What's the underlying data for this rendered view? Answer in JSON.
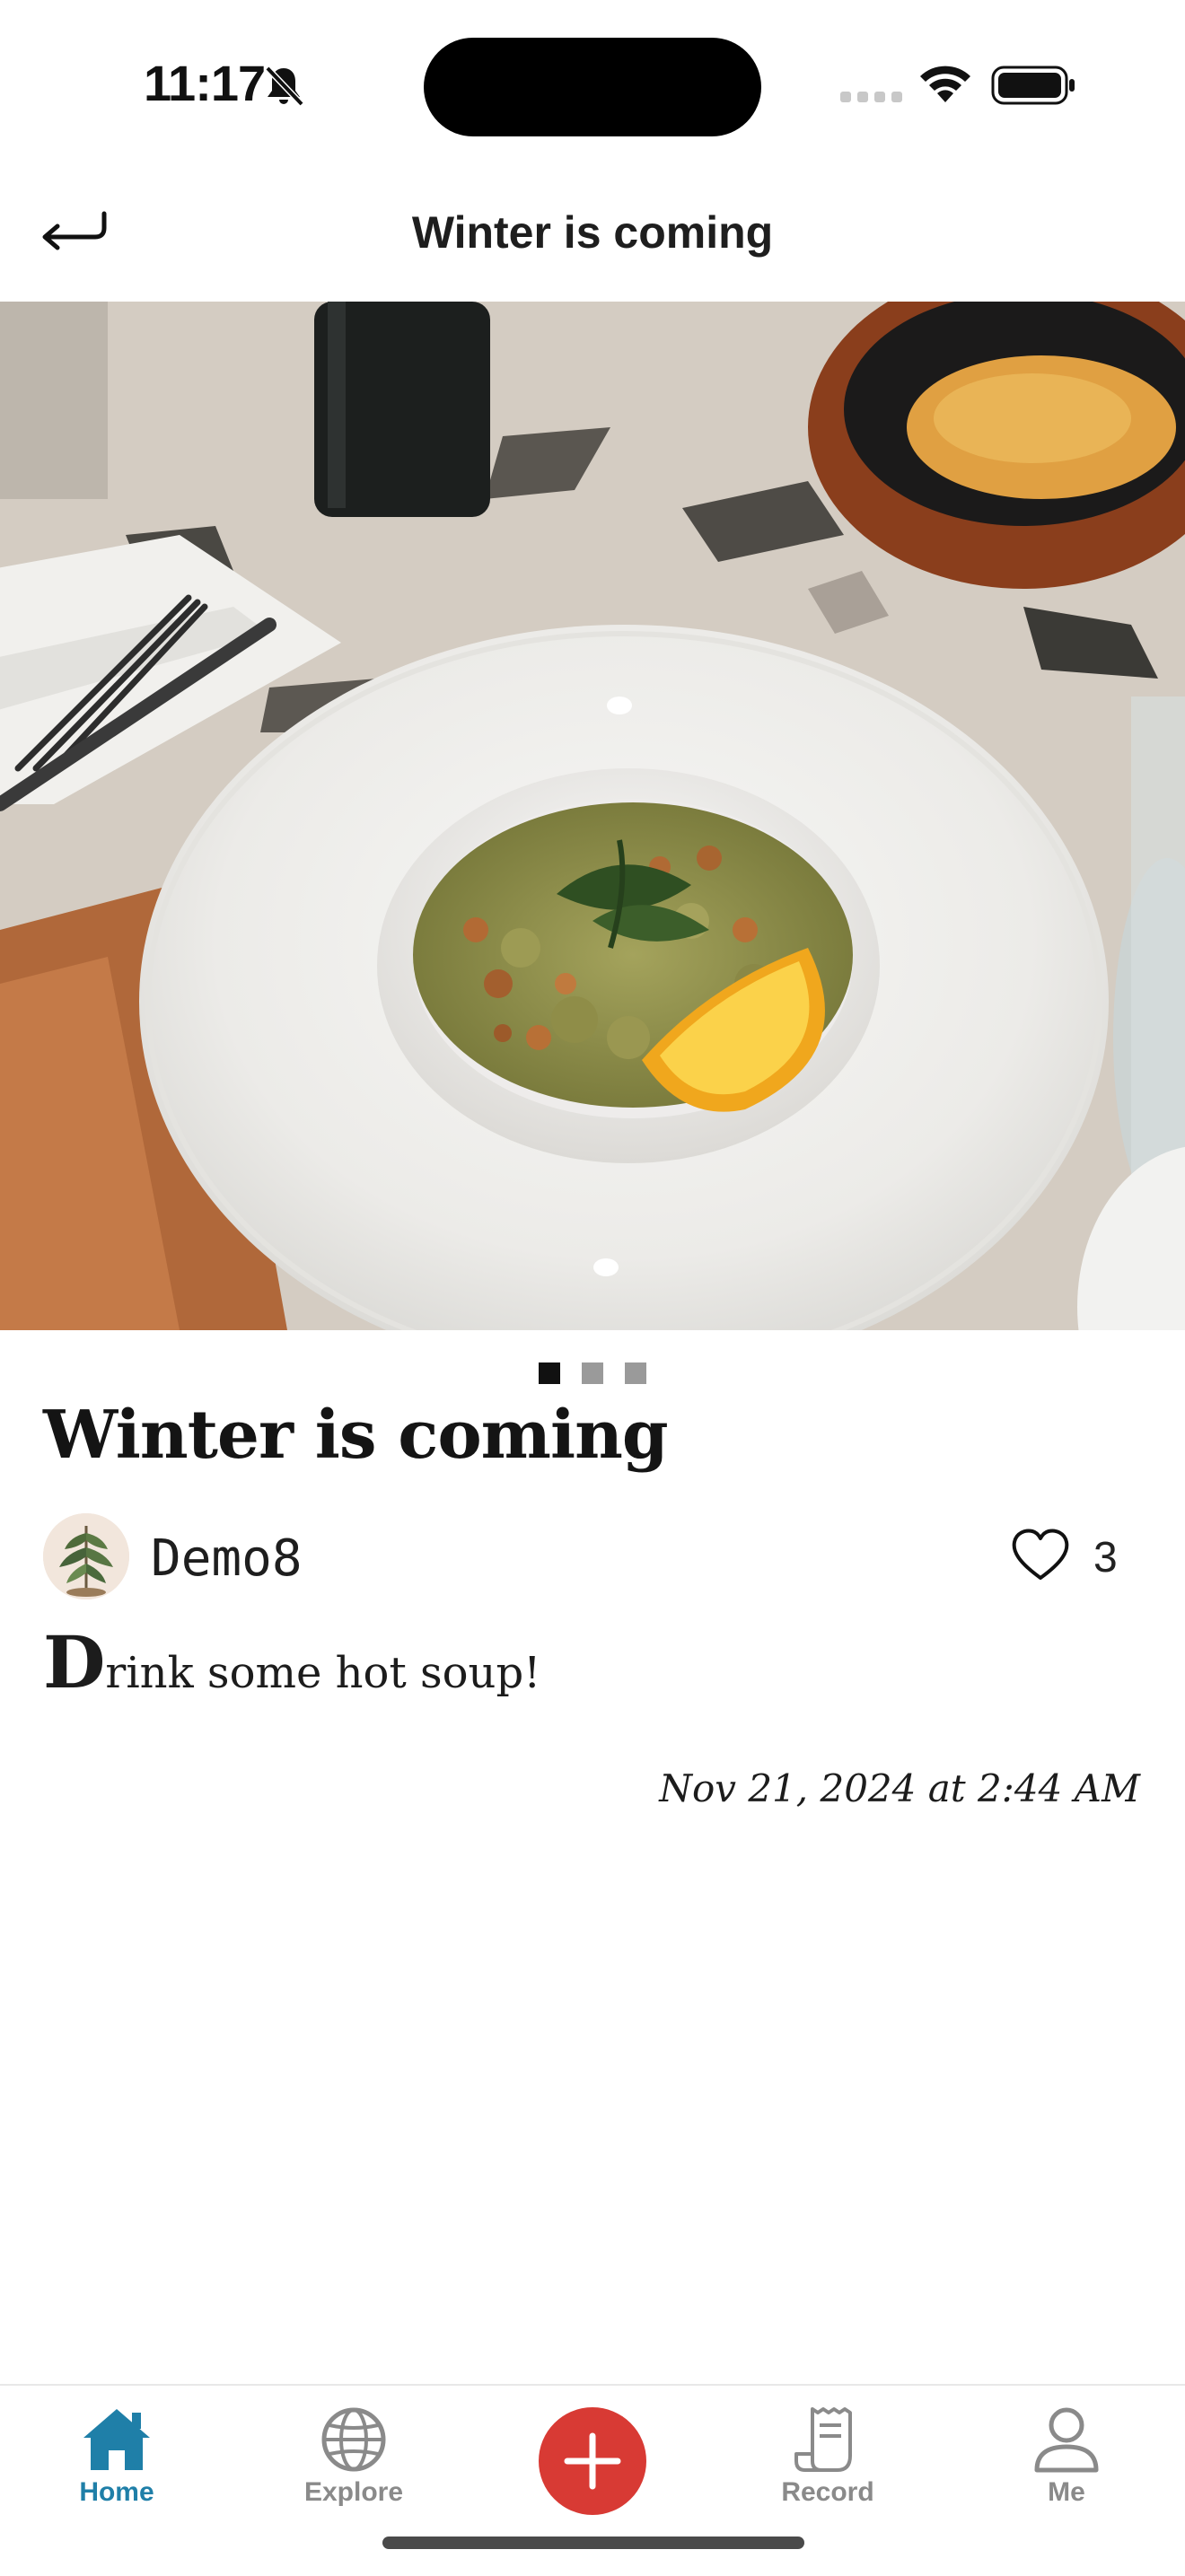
{
  "status_bar": {
    "time": "11:17",
    "icons": [
      "bell-slash-icon",
      "cellular-signal-icon",
      "wifi-icon",
      "battery-icon"
    ]
  },
  "header": {
    "title": "Winter is coming",
    "back_icon": "return-arrow-icon"
  },
  "post": {
    "photo": "plated soup bowl with lemon wedge on a table",
    "carousel": {
      "count": 3,
      "active_index": 0
    },
    "title": "Winter is coming",
    "author": {
      "name": "Demo8",
      "avatar_icon": "plant-avatar"
    },
    "likes": {
      "icon": "heart-outline-icon",
      "count": "3"
    },
    "body": {
      "drop_cap": "D",
      "rest": "rink some hot soup!"
    },
    "date": "Nov 21, 2024 at 2:44 AM"
  },
  "tab_bar": {
    "items": [
      {
        "label": "Home",
        "icon": "house-icon",
        "active": true
      },
      {
        "label": "Explore",
        "icon": "globe-icon",
        "active": false
      },
      {
        "label": "",
        "icon": "plus-icon",
        "active": false
      },
      {
        "label": "Record",
        "icon": "receipt-icon",
        "active": false
      },
      {
        "label": "Me",
        "icon": "person-icon",
        "active": false
      }
    ]
  },
  "colors": {
    "accent": "#1f7fa8",
    "add_button": "#d83a34",
    "inactive_tab": "#8a8a8a",
    "text": "#141414"
  }
}
